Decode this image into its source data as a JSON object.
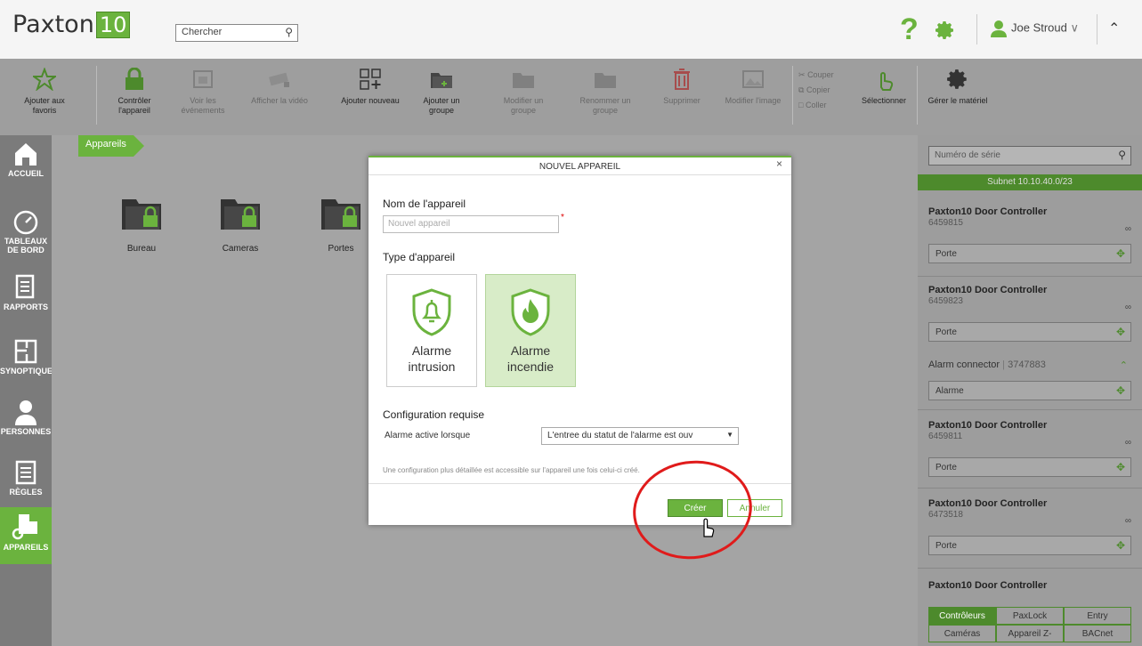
{
  "app": {
    "logo_text": "Paxton",
    "logo_num": "10"
  },
  "header": {
    "search_placeholder": "Chercher",
    "help_label": "?",
    "user_name": "Joe Stroud",
    "user_caret": "∨",
    "collapse_label": "^"
  },
  "ribbon": {
    "favorites": "Ajouter aux favoris",
    "control": "Contrôler l'appareil",
    "events": "Voir les événements",
    "video": "Afficher la vidéo",
    "add_new": "Ajouter nouveau",
    "add_group": "Ajouter un groupe",
    "edit_group": "Modifier un groupe",
    "rename_group": "Renommer un groupe",
    "delete": "Supprimer",
    "edit_image": "Modifier l'image",
    "cut": "Couper",
    "copy": "Copier",
    "paste": "Coller",
    "select": "Sélectionner",
    "manage_hw": "Gérer le matériel"
  },
  "sidebar": {
    "items": [
      {
        "label": "ACCUEIL"
      },
      {
        "label": "TABLEAUX DE BORD"
      },
      {
        "label": "RAPPORTS"
      },
      {
        "label": "SYNOPTIQUES"
      },
      {
        "label": "PERSONNES"
      },
      {
        "label": "RÈGLES"
      },
      {
        "label": "APPAREILS"
      }
    ]
  },
  "main": {
    "breadcrumb": "Appareils",
    "folders": [
      {
        "label": "Bureau"
      },
      {
        "label": "Cameras"
      },
      {
        "label": "Portes"
      }
    ]
  },
  "right_panel": {
    "serial_placeholder": "Numéro de série",
    "subnet": "Subnet 10.10.40.0/23",
    "devices": [
      {
        "name": "Paxton10 Door Controller",
        "serial": "6459815",
        "port": "Porte"
      },
      {
        "name": "Paxton10 Door Controller",
        "serial": "6459823",
        "port": "Porte"
      },
      {
        "name": "Alarm connector",
        "serial": "3747883",
        "port": "Alarme"
      },
      {
        "name": "Paxton10 Door Controller",
        "serial": "6459811",
        "port": "Porte"
      },
      {
        "name": "Paxton10 Door Controller",
        "serial": "6473518",
        "port": "Porte"
      },
      {
        "name": "Paxton10 Door Controller",
        "serial": "",
        "port": ""
      }
    ],
    "tabs": [
      "Contrôleurs",
      "PaxLock",
      "Entry",
      "Caméras",
      "Appareil Z-",
      "BACnet"
    ]
  },
  "modal": {
    "title": "NOUVEL APPAREIL",
    "close": "×",
    "name_label": "Nom de l'appareil",
    "name_placeholder": "Nouvel appareil",
    "required_mark": "*",
    "type_label": "Type d'appareil",
    "types": [
      {
        "line1": "Alarme",
        "line2": "intrusion"
      },
      {
        "line1": "Alarme",
        "line2": "incendie"
      }
    ],
    "config_label": "Configuration requise",
    "field_label": "Alarme active lorsque",
    "field_value": "L'entree du statut de l'alarme est ouv",
    "note": "Une configuration plus détaillée est accessible sur l'appareil une fois celui-ci créé.",
    "create": "Créer",
    "cancel": "Annuler"
  }
}
